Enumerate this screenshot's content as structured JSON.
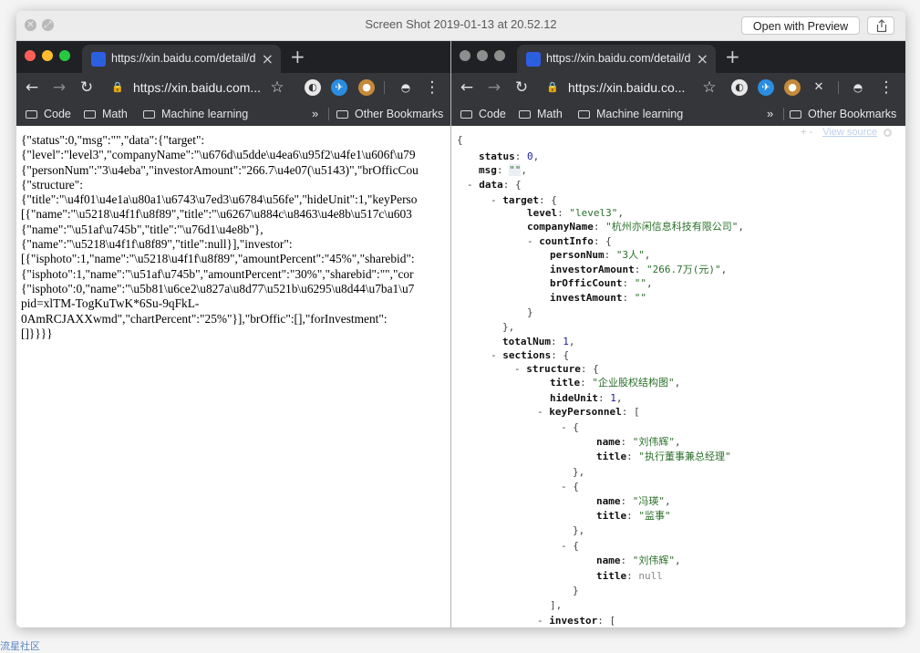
{
  "preview": {
    "title": "Screen Shot 2019-01-13 at 20.52.12",
    "open_button": "Open with Preview"
  },
  "watermark": "流星社区",
  "left_browser": {
    "tab_title": "https://xin.baidu.com/detail/da",
    "url": "https://xin.baidu.com...",
    "bookmarks": [
      "Code",
      "Math",
      "Machine learning"
    ],
    "bookmarks_overflow": "»",
    "other_bookmarks": "Other Bookmarks",
    "raw_lines": [
      "{\"status\":0,\"msg\":\"\",\"data\":{\"target\":",
      "{\"level\":\"level3\",\"companyName\":\"\\u676d\\u5dde\\u4ea6\\u95f2\\u4fe1\\u606f\\u79",
      "{\"personNum\":\"3\\u4eba\",\"investorAmount\":\"266.7\\u4e07(\\u5143)\",\"brOfficCou",
      "{\"structure\":",
      "{\"title\":\"\\u4f01\\u4e1a\\u80a1\\u6743\\u7ed3\\u6784\\u56fe\",\"hideUnit\":1,\"keyPerso",
      "[{\"name\":\"\\u5218\\u4f1f\\u8f89\",\"title\":\"\\u6267\\u884c\\u8463\\u4e8b\\u517c\\u603",
      "{\"name\":\"\\u51af\\u745b\",\"title\":\"\\u76d1\\u4e8b\"},",
      "{\"name\":\"\\u5218\\u4f1f\\u8f89\",\"title\":null}],\"investor\":",
      "[{\"isphoto\":1,\"name\":\"\\u5218\\u4f1f\\u8f89\",\"amountPercent\":\"45%\",\"sharebid\":",
      "{\"isphoto\":1,\"name\":\"\\u51af\\u745b\",\"amountPercent\":\"30%\",\"sharebid\":\"\",\"cor",
      "{\"isphoto\":0,\"name\":\"\\u5b81\\u6ce2\\u827a\\u8d77\\u521b\\u6295\\u8d44\\u7ba1\\u7",
      "pid=xlTM-TogKuTwK*6Su-9qFkL-",
      "0AmRCJAXXwmd\",\"chartPercent\":\"25%\"}],\"brOffic\":[],\"forInvestment\":",
      "[]}}}}"
    ]
  },
  "right_browser": {
    "tab_title": "https://xin.baidu.com/detail/da",
    "url": "https://xin.baidu.co...",
    "bookmarks": [
      "Code",
      "Math",
      "Machine learning"
    ],
    "bookmarks_overflow": "»",
    "other_bookmarks": "Other Bookmarks",
    "viewer_plusminus": "+ -",
    "view_source": "View source",
    "json_lines": [
      {
        "parts": [
          {
            "t": "{",
            "c": "p"
          }
        ]
      },
      {
        "parts": [
          {
            "t": "status",
            "c": "k"
          },
          {
            "t": ": ",
            "c": "p"
          },
          {
            "t": "0",
            "c": "n"
          },
          {
            "t": ",",
            "c": "p"
          }
        ]
      },
      {
        "parts": [
          {
            "t": "msg",
            "c": "k"
          },
          {
            "t": ": ",
            "c": "p"
          },
          {
            "t": "\"\"",
            "c": "s",
            "hl": true
          },
          {
            "t": ",",
            "c": "p"
          }
        ]
      },
      {
        "parts": [
          {
            "t": "- ",
            "c": "e"
          },
          {
            "t": "data",
            "c": "k"
          },
          {
            "t": ": {",
            "c": "p"
          }
        ]
      },
      {
        "parts": [
          {
            "t": "- ",
            "c": "e"
          },
          {
            "t": "target",
            "c": "k"
          },
          {
            "t": ": {",
            "c": "p"
          }
        ]
      },
      {
        "parts": [
          {
            "t": "level",
            "c": "k"
          },
          {
            "t": ": ",
            "c": "p"
          },
          {
            "t": "\"level3\"",
            "c": "s"
          },
          {
            "t": ",",
            "c": "p"
          }
        ]
      },
      {
        "parts": [
          {
            "t": "companyName",
            "c": "k"
          },
          {
            "t": ": ",
            "c": "p"
          },
          {
            "t": "\"杭州亦闲信息科技有限公司\"",
            "c": "s"
          },
          {
            "t": ",",
            "c": "p"
          }
        ]
      },
      {
        "parts": [
          {
            "t": "- ",
            "c": "e"
          },
          {
            "t": "countInfo",
            "c": "k"
          },
          {
            "t": ": {",
            "c": "p"
          }
        ]
      },
      {
        "parts": [
          {
            "t": "personNum",
            "c": "k"
          },
          {
            "t": ": ",
            "c": "p"
          },
          {
            "t": "\"3人\"",
            "c": "s"
          },
          {
            "t": ",",
            "c": "p"
          }
        ]
      },
      {
        "parts": [
          {
            "t": "investorAmount",
            "c": "k"
          },
          {
            "t": ": ",
            "c": "p"
          },
          {
            "t": "\"266.7万(元)\"",
            "c": "s"
          },
          {
            "t": ",",
            "c": "p"
          }
        ]
      },
      {
        "parts": [
          {
            "t": "brOfficCount",
            "c": "k"
          },
          {
            "t": ": ",
            "c": "p"
          },
          {
            "t": "\"\"",
            "c": "s"
          },
          {
            "t": ",",
            "c": "p"
          }
        ]
      },
      {
        "parts": [
          {
            "t": "investAmount",
            "c": "k"
          },
          {
            "t": ": ",
            "c": "p"
          },
          {
            "t": "\"\"",
            "c": "s"
          }
        ]
      },
      {
        "parts": [
          {
            "t": "}",
            "c": "p"
          }
        ]
      },
      {
        "parts": [
          {
            "t": "},",
            "c": "p"
          }
        ]
      },
      {
        "parts": [
          {
            "t": "totalNum",
            "c": "k"
          },
          {
            "t": ": ",
            "c": "p"
          },
          {
            "t": "1",
            "c": "n"
          },
          {
            "t": ",",
            "c": "p"
          }
        ]
      },
      {
        "parts": [
          {
            "t": "- ",
            "c": "e"
          },
          {
            "t": "sections",
            "c": "k"
          },
          {
            "t": ": {",
            "c": "p"
          }
        ]
      },
      {
        "parts": [
          {
            "t": "- ",
            "c": "e"
          },
          {
            "t": "structure",
            "c": "k"
          },
          {
            "t": ": {",
            "c": "p"
          }
        ]
      },
      {
        "parts": [
          {
            "t": "title",
            "c": "k"
          },
          {
            "t": ": ",
            "c": "p"
          },
          {
            "t": "\"企业股权结构图\"",
            "c": "s"
          },
          {
            "t": ",",
            "c": "p"
          }
        ]
      },
      {
        "parts": [
          {
            "t": "hideUnit",
            "c": "k"
          },
          {
            "t": ": ",
            "c": "p"
          },
          {
            "t": "1",
            "c": "n"
          },
          {
            "t": ",",
            "c": "p"
          }
        ]
      },
      {
        "parts": [
          {
            "t": "- ",
            "c": "e"
          },
          {
            "t": "keyPersonnel",
            "c": "k"
          },
          {
            "t": ": [",
            "c": "p"
          }
        ]
      },
      {
        "parts": [
          {
            "t": "- ",
            "c": "e"
          },
          {
            "t": "{",
            "c": "p"
          }
        ]
      },
      {
        "parts": [
          {
            "t": "name",
            "c": "k"
          },
          {
            "t": ": ",
            "c": "p"
          },
          {
            "t": "\"刘伟辉\"",
            "c": "s"
          },
          {
            "t": ",",
            "c": "p"
          }
        ]
      },
      {
        "parts": [
          {
            "t": "title",
            "c": "k"
          },
          {
            "t": ": ",
            "c": "p"
          },
          {
            "t": "\"执行董事兼总经理\"",
            "c": "s"
          }
        ]
      },
      {
        "parts": [
          {
            "t": "},",
            "c": "p"
          }
        ]
      },
      {
        "parts": [
          {
            "t": "- ",
            "c": "e"
          },
          {
            "t": "{",
            "c": "p"
          }
        ]
      },
      {
        "parts": [
          {
            "t": "name",
            "c": "k"
          },
          {
            "t": ": ",
            "c": "p"
          },
          {
            "t": "\"冯瑛\"",
            "c": "s"
          },
          {
            "t": ",",
            "c": "p"
          }
        ]
      },
      {
        "parts": [
          {
            "t": "title",
            "c": "k"
          },
          {
            "t": ": ",
            "c": "p"
          },
          {
            "t": "\"监事\"",
            "c": "s"
          }
        ]
      },
      {
        "parts": [
          {
            "t": "},",
            "c": "p"
          }
        ]
      },
      {
        "parts": [
          {
            "t": "- ",
            "c": "e"
          },
          {
            "t": "{",
            "c": "p"
          }
        ]
      },
      {
        "parts": [
          {
            "t": "name",
            "c": "k"
          },
          {
            "t": ": ",
            "c": "p"
          },
          {
            "t": "\"刘伟辉\"",
            "c": "s"
          },
          {
            "t": ",",
            "c": "p"
          }
        ]
      },
      {
        "parts": [
          {
            "t": "title",
            "c": "k"
          },
          {
            "t": ": ",
            "c": "p"
          },
          {
            "t": "null",
            "c": "x"
          }
        ]
      },
      {
        "parts": [
          {
            "t": "}",
            "c": "p"
          }
        ]
      },
      {
        "parts": [
          {
            "t": "],",
            "c": "p"
          }
        ]
      },
      {
        "parts": [
          {
            "t": "- ",
            "c": "e"
          },
          {
            "t": "investor",
            "c": "k"
          },
          {
            "t": ": [",
            "c": "p"
          }
        ]
      }
    ]
  }
}
